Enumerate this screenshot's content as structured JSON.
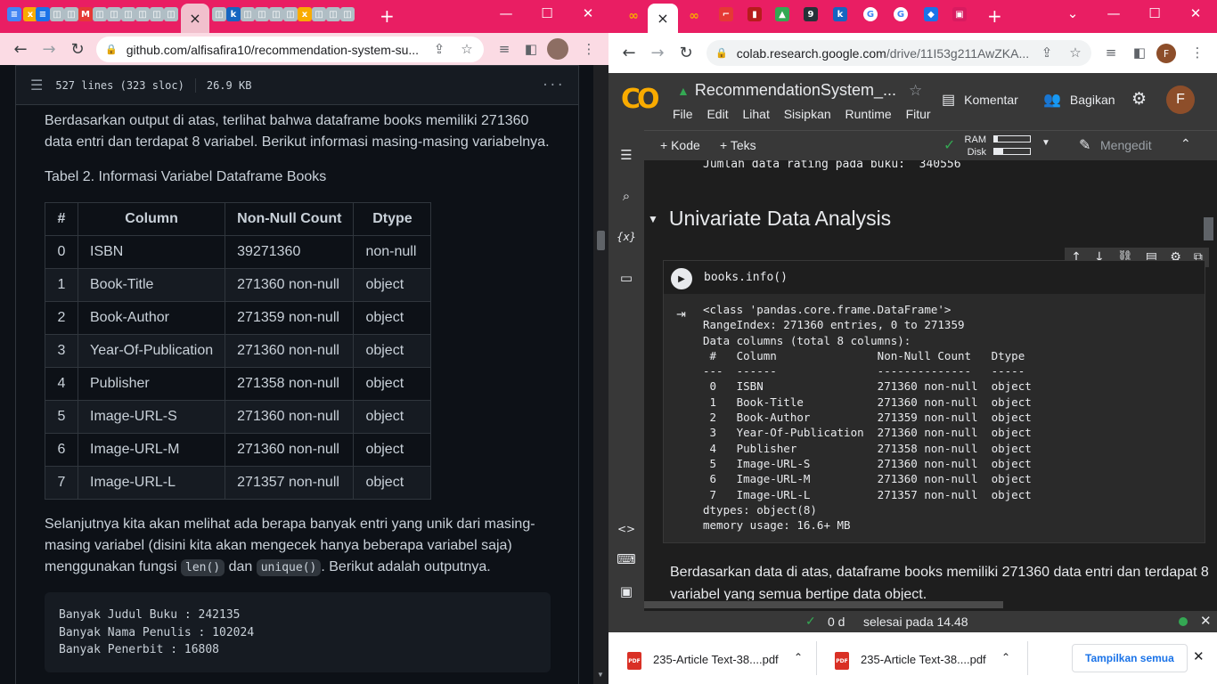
{
  "left": {
    "gh_header": {
      "lines": "527 lines (323 sloc)",
      "size": "26.9 KB",
      "more": "···"
    },
    "para1": "Berdasarkan output di atas, terlihat bahwa dataframe books memiliki 271360 data entri dan terdapat 8 variabel. Berikut informasi masing-masing variabelnya.",
    "table_caption": "Tabel 2. Informasi Variabel Dataframe Books",
    "table": {
      "headers": [
        "#",
        "Column",
        "Non-Null Count",
        "Dtype"
      ],
      "rows": [
        [
          "0",
          "ISBN",
          "39271360",
          "non-null"
        ],
        [
          "1",
          "Book-Title",
          "271360 non-null",
          "object"
        ],
        [
          "2",
          "Book-Author",
          "271359 non-null",
          "object"
        ],
        [
          "3",
          "Year-Of-Publication",
          "271360 non-null",
          "object"
        ],
        [
          "4",
          "Publisher",
          "271358 non-null",
          "object"
        ],
        [
          "5",
          "Image-URL-S",
          "271360 non-null",
          "object"
        ],
        [
          "6",
          "Image-URL-M",
          "271360 non-null",
          "object"
        ],
        [
          "7",
          "Image-URL-L",
          "271357 non-null",
          "object"
        ]
      ]
    },
    "para2a": "Selanjutnya kita akan melihat ada berapa banyak entri yang unik dari masing-masing variabel (disini kita akan mengecek hanya beberapa variabel saja) menggunakan fungsi ",
    "code1": "len()",
    "para2b": " dan ",
    "code2": "unique()",
    "para2c": ". Berikut adalah outputnya.",
    "code_block": "Banyak Judul Buku : 242135\nBanyak Nama Penulis : 102024\nBanyak Penerbit : 16808",
    "url": "github.com/alfisafira10/recommendation-system-su..."
  },
  "right": {
    "url_host": "colab.research.google.com",
    "url_path": "/drive/11I53g211AwZKA...",
    "avatar": "F",
    "title": "RecommendationSystem_...",
    "menu": [
      "File",
      "Edit",
      "Lihat",
      "Sisipkan",
      "Runtime",
      "Fitur"
    ],
    "komentar": "Komentar",
    "bagikan": "Bagikan",
    "add_code": "+ Kode",
    "add_text": "+ Teks",
    "ram": "RAM",
    "disk": "Disk",
    "mengedit": "Mengedit",
    "prev_output": "Jumlah data rating pada buku:  340556",
    "section_title": "Univariate Data Analysis",
    "cell_code": "books.info()",
    "cell_output": "<class 'pandas.core.frame.DataFrame'>\nRangeIndex: 271360 entries, 0 to 271359\nData columns (total 8 columns):\n #   Column               Non-Null Count   Dtype \n---  ------               --------------   ----- \n 0   ISBN                 271360 non-null  object\n 1   Book-Title           271360 non-null  object\n 2   Book-Author          271359 non-null  object\n 3   Year-Of-Publication  271360 non-null  object\n 4   Publisher            271358 non-null  object\n 5   Image-URL-S          271360 non-null  object\n 6   Image-URL-M          271360 non-null  object\n 7   Image-URL-L          271357 non-null  object\ndtypes: object(8)\nmemory usage: 16.6+ MB",
    "text_after": "Berdasarkan data di atas, dataframe books memiliki 271360 data entri dan terdapat 8 variabel yang semua bertipe data object.",
    "status_time": "0 d",
    "status_done": "selesai pada 14.48",
    "downloads": [
      "235-Article Text-38....pdf",
      "235-Article Text-38....pdf"
    ],
    "show_all": "Tampilkan semua"
  },
  "colors": {
    "tabstrip": "#e91e63",
    "gh_bg": "#0d1117",
    "colab_bg": "#1e1e1e",
    "colab_orange": "#f9ab00"
  },
  "icons": {
    "close": "×",
    "newtab": "+",
    "back": "←",
    "forward": "→",
    "reload": "↻",
    "star": "☆",
    "lock": "🔒"
  }
}
